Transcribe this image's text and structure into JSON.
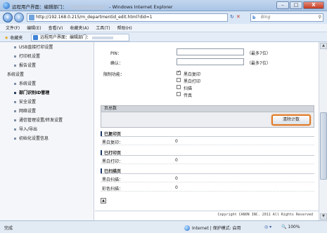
{
  "window": {
    "title_prefix": "远程用户界面：编辑部门：",
    "title_suffix": "- Windows Internet Explorer",
    "min_label": "–",
    "max_label": "□",
    "close_label": "X"
  },
  "address_bar": {
    "url": "http://192.168.0.215/m_departmentid_edit.html?did=1",
    "refresh": "↻",
    "stop": "✕",
    "search_placeholder": "Bing",
    "bing_glyph": "b",
    "search_icon_glyph": "⚲"
  },
  "menu": [
    "文件(F)",
    "编辑(E)",
    "查看(V)",
    "收藏夹(A)",
    "工具(T)",
    "帮助(H)"
  ],
  "favorites": {
    "label": "收藏夹",
    "tab_title": "远程用户界面：编辑部门："
  },
  "sidebar": {
    "items_top": [
      "USB直接打印设置",
      "打印机设置",
      "报告设置"
    ],
    "section_label": "系统设置",
    "items": [
      "系统设置",
      "部门识别ID管理",
      "安全设置",
      "网络设置",
      "通信管理设置/转发设置",
      "导入/导出",
      "初始化设置信息"
    ],
    "active_index": 1
  },
  "form": {
    "pin_label": "PIN：",
    "pin_hint": "（最多7位）",
    "confirm_label": "确认：",
    "confirm_hint": "（最多7位）",
    "restrict_label": "限制功能：",
    "functions": [
      {
        "label": "黑白复印",
        "checked": true
      },
      {
        "label": "黑白打印",
        "checked": false
      },
      {
        "label": "扫描",
        "checked": false
      },
      {
        "label": "传真",
        "checked": false
      }
    ]
  },
  "page_total": {
    "header": "页总数",
    "clear_button": "清除计数"
  },
  "groups": [
    {
      "title": "已复印页",
      "rows": [
        {
          "key": "黑白复印：",
          "value": "0"
        }
      ]
    },
    {
      "title": "已打印页",
      "rows": [
        {
          "key": "黑白打印：",
          "value": "0"
        }
      ]
    },
    {
      "title": "已扫描页",
      "rows": [
        {
          "key": "黑白扫描：",
          "value": "0"
        },
        {
          "key": "彩色扫描：",
          "value": "0"
        }
      ]
    }
  ],
  "footer": {
    "copyright": "Copyright CANON INC. 2011 All Rights Reserved",
    "top_glyph": "▲"
  },
  "status": {
    "text": "完成",
    "zone": "Internet | 保护模式: 启用",
    "zoom": "🔍 100%",
    "extra": "◎ ▾"
  }
}
